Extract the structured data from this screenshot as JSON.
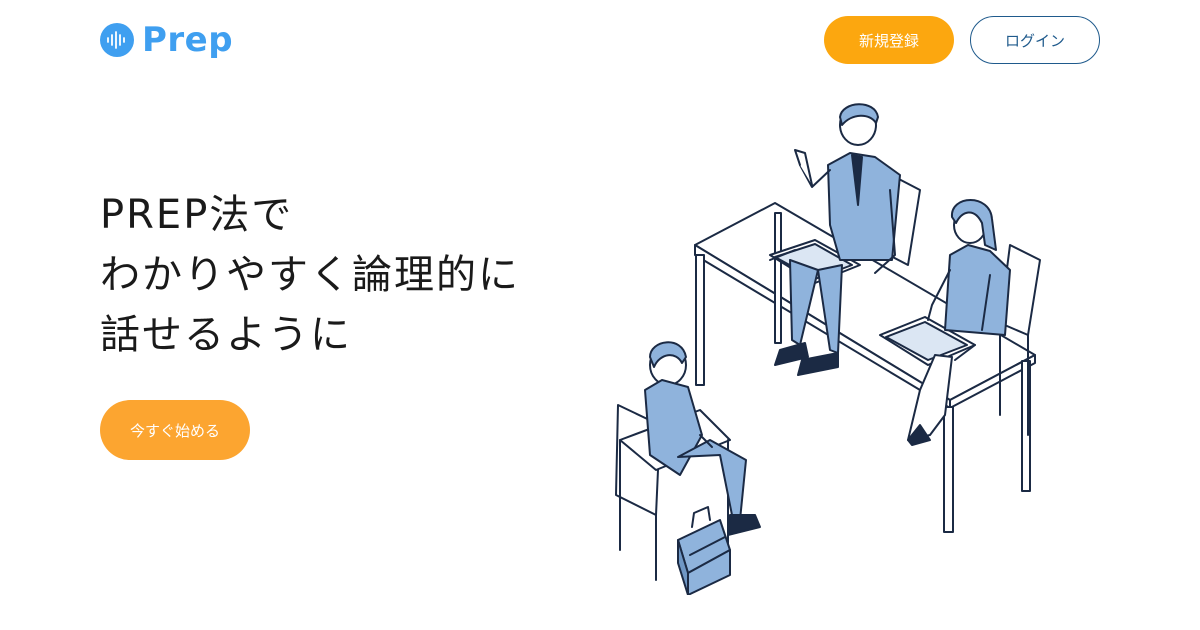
{
  "header": {
    "logo_text": "Prep",
    "register_label": "新規登録",
    "login_label": "ログイン"
  },
  "hero": {
    "title_lines": [
      "PREP法で",
      "わかりやすく論理的に",
      "話せるように"
    ],
    "cta_label": "今すぐ始める"
  },
  "colors": {
    "brand_blue": "#3f9ff0",
    "accent_orange": "#fca70f",
    "outline_navy": "#1f5a8c",
    "illustration_blue": "#8fb3dc",
    "illustration_navy": "#1b2a44"
  },
  "illustration": {
    "subject": "interview-scene"
  }
}
